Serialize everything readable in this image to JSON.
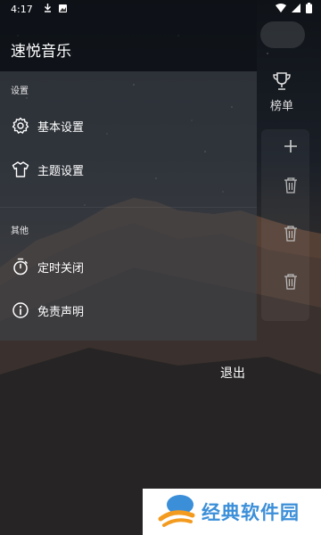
{
  "status_bar": {
    "time": "4:17"
  },
  "drawer": {
    "app_title": "速悦音乐",
    "sections": [
      {
        "label": "设置",
        "items": [
          {
            "label": "基本设置",
            "icon": "gear-icon"
          },
          {
            "label": "主题设置",
            "icon": "shirt-icon"
          }
        ]
      },
      {
        "label": "其他",
        "items": [
          {
            "label": "定时关闭",
            "icon": "timer-icon"
          },
          {
            "label": "免责声明",
            "icon": "info-icon"
          }
        ]
      }
    ]
  },
  "main": {
    "ranking_label": "榜单",
    "exit_label": "退出"
  },
  "watermark": {
    "text": "经典软件园"
  },
  "colors": {
    "drawer_header": "#0e1218",
    "drawer_body": "#3e4248",
    "watermark_text": "#3b8fd9"
  }
}
